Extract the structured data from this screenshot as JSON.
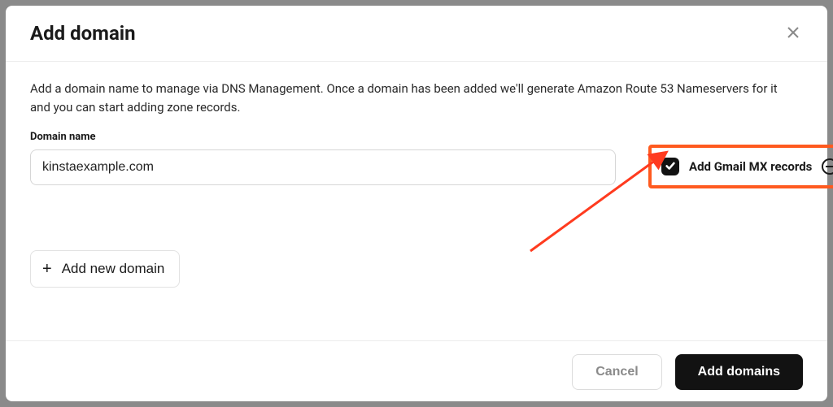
{
  "modal": {
    "title": "Add domain",
    "description": "Add a domain name to manage via DNS Management. Once a domain has been added we'll generate Amazon Route 53 Nameservers for it and you can start adding zone records.",
    "domain_label": "Domain name",
    "domain_value": "kinstaexample.com",
    "gmail_mx_label": "Add Gmail MX records",
    "gmail_mx_checked": true,
    "add_new_domain_label": "Add new domain",
    "cancel_label": "Cancel",
    "submit_label": "Add domains"
  },
  "annotation": {
    "highlight_color": "#ff5a1f"
  }
}
